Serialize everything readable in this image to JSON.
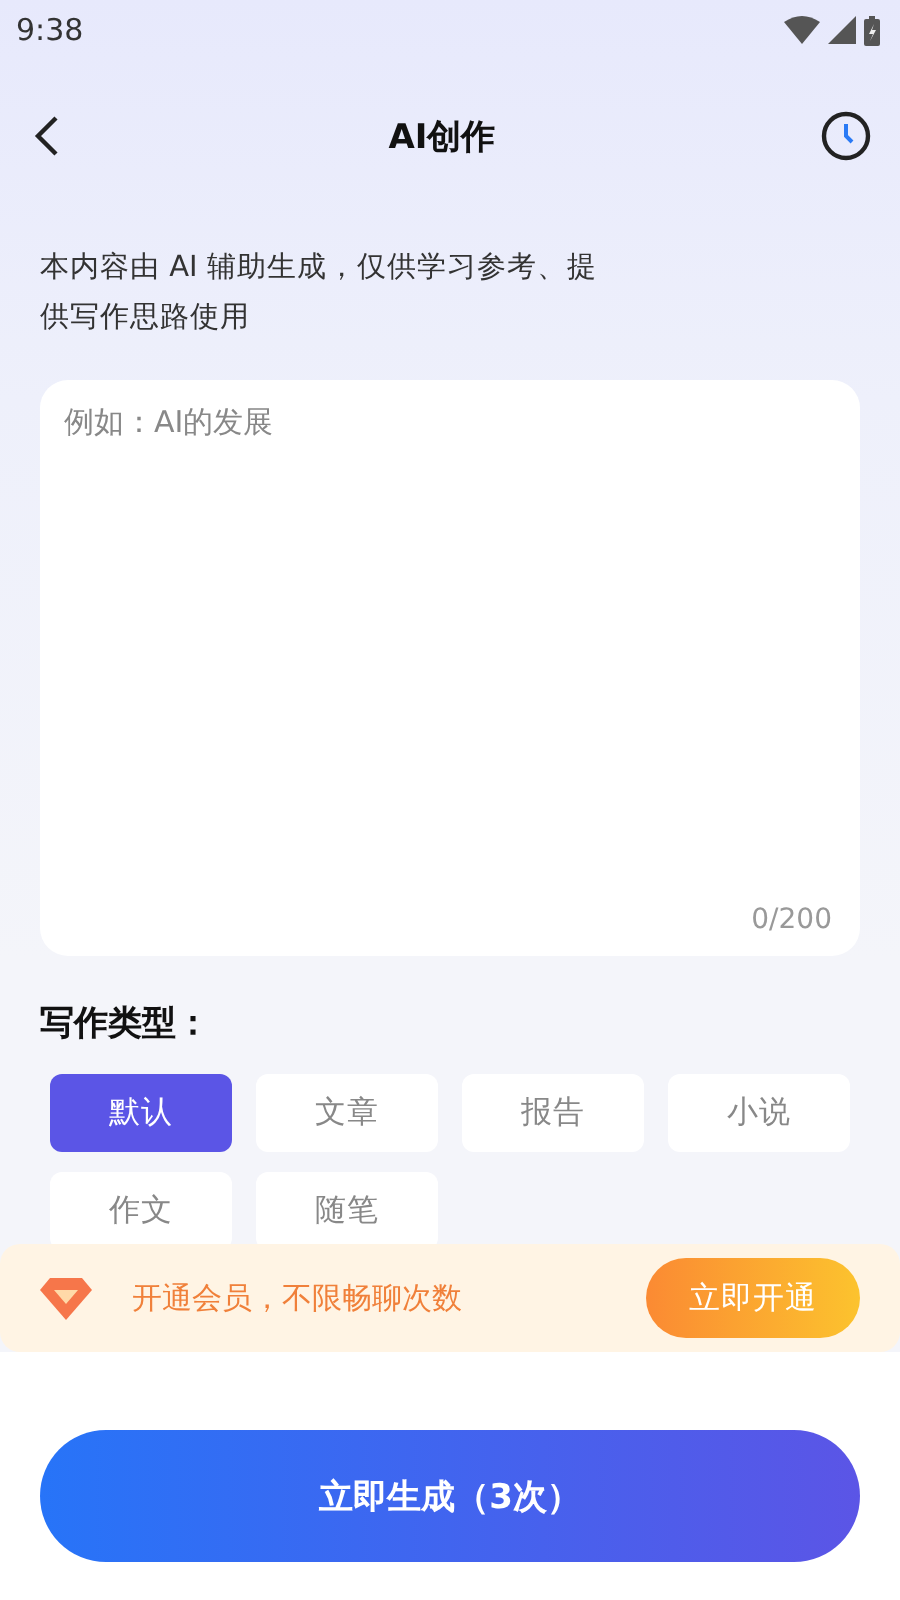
{
  "status_bar": {
    "time": "9:38"
  },
  "header": {
    "title": "AI创作"
  },
  "disclaimer": "本内容由 AI 辅助生成，仅供学习参考、提供写作思路使用",
  "input": {
    "placeholder": "例如：AI的发展",
    "counter": "0/200"
  },
  "types": {
    "label": "写作类型：",
    "options": [
      {
        "label": "默认",
        "selected": true
      },
      {
        "label": "文章",
        "selected": false
      },
      {
        "label": "报告",
        "selected": false
      },
      {
        "label": "小说",
        "selected": false
      },
      {
        "label": "作文",
        "selected": false
      },
      {
        "label": "随笔",
        "selected": false
      }
    ]
  },
  "vip_banner": {
    "text": "开通会员，不限畅聊次数",
    "button": "立即开通"
  },
  "generate_button": "立即生成（3次）"
}
